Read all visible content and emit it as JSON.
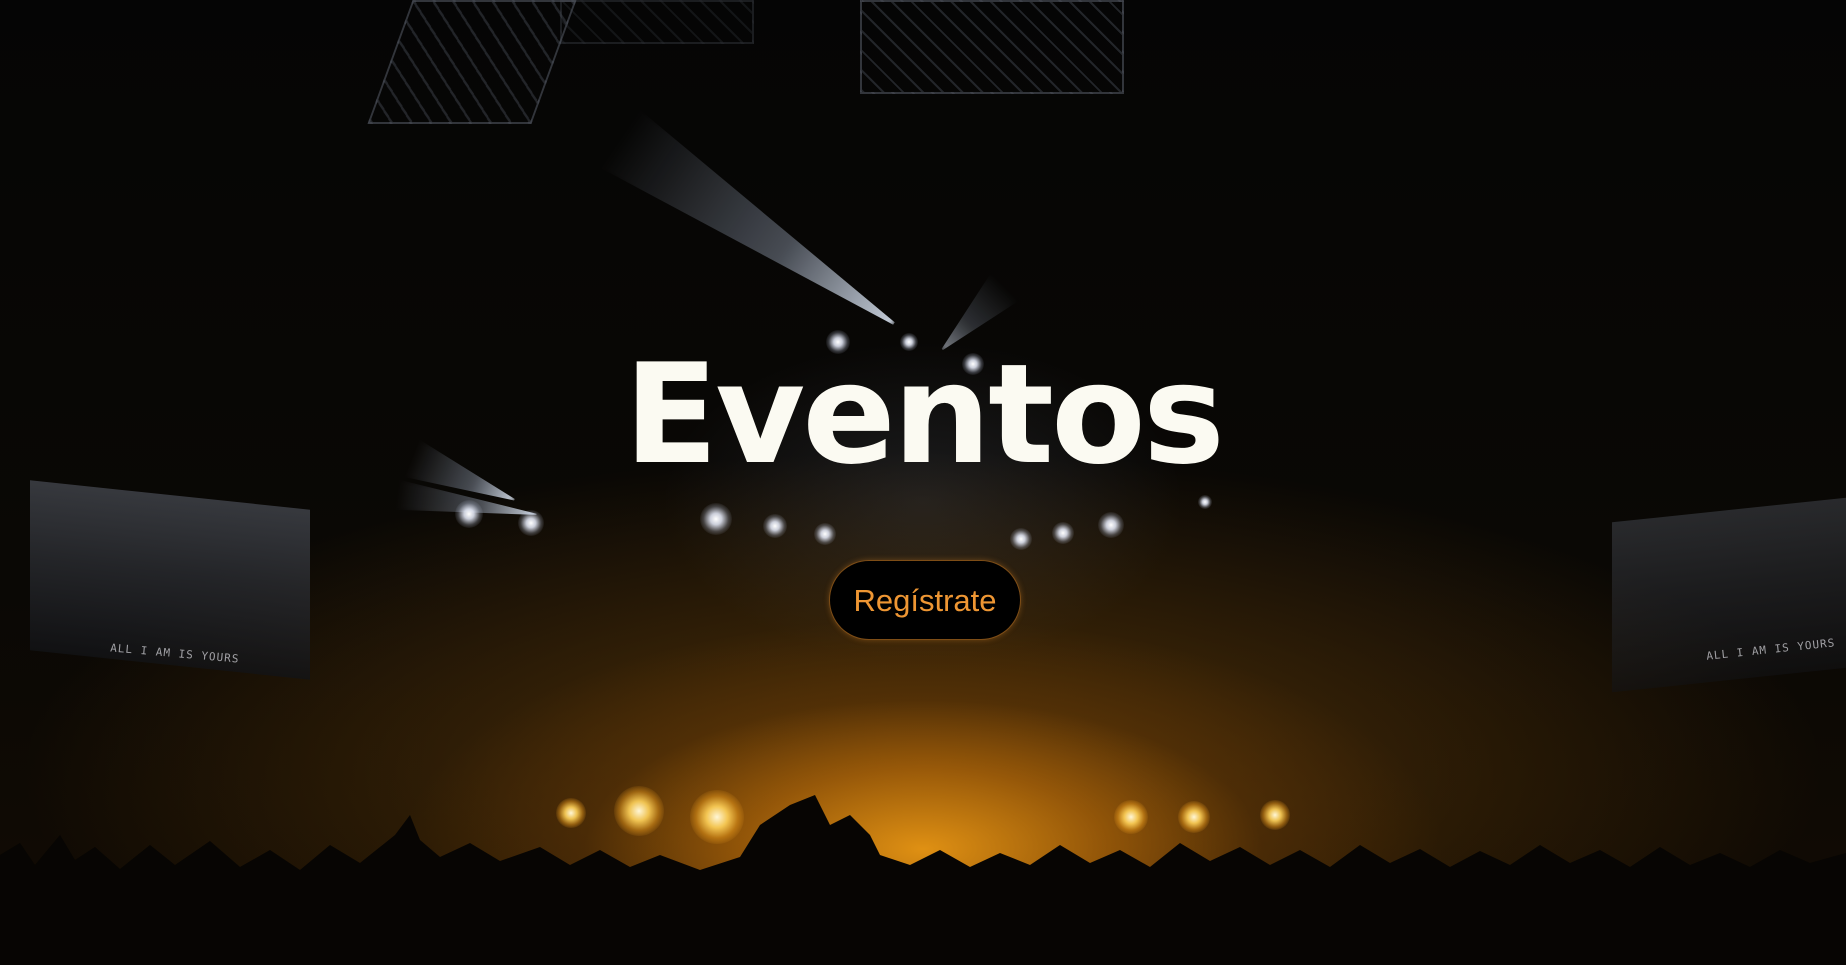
{
  "hero": {
    "title": "Eventos",
    "cta_label": "Regístrate",
    "background_image": "concert-crowd-stage-lights",
    "screen_left_text": "ALL I AM IS YOURS",
    "screen_right_text": "ALL I AM IS YOURS"
  },
  "colors": {
    "title": "#fbfaf2",
    "cta_text": "#ee9633",
    "cta_background": "#000000",
    "stage_glow": "#e8961e"
  }
}
